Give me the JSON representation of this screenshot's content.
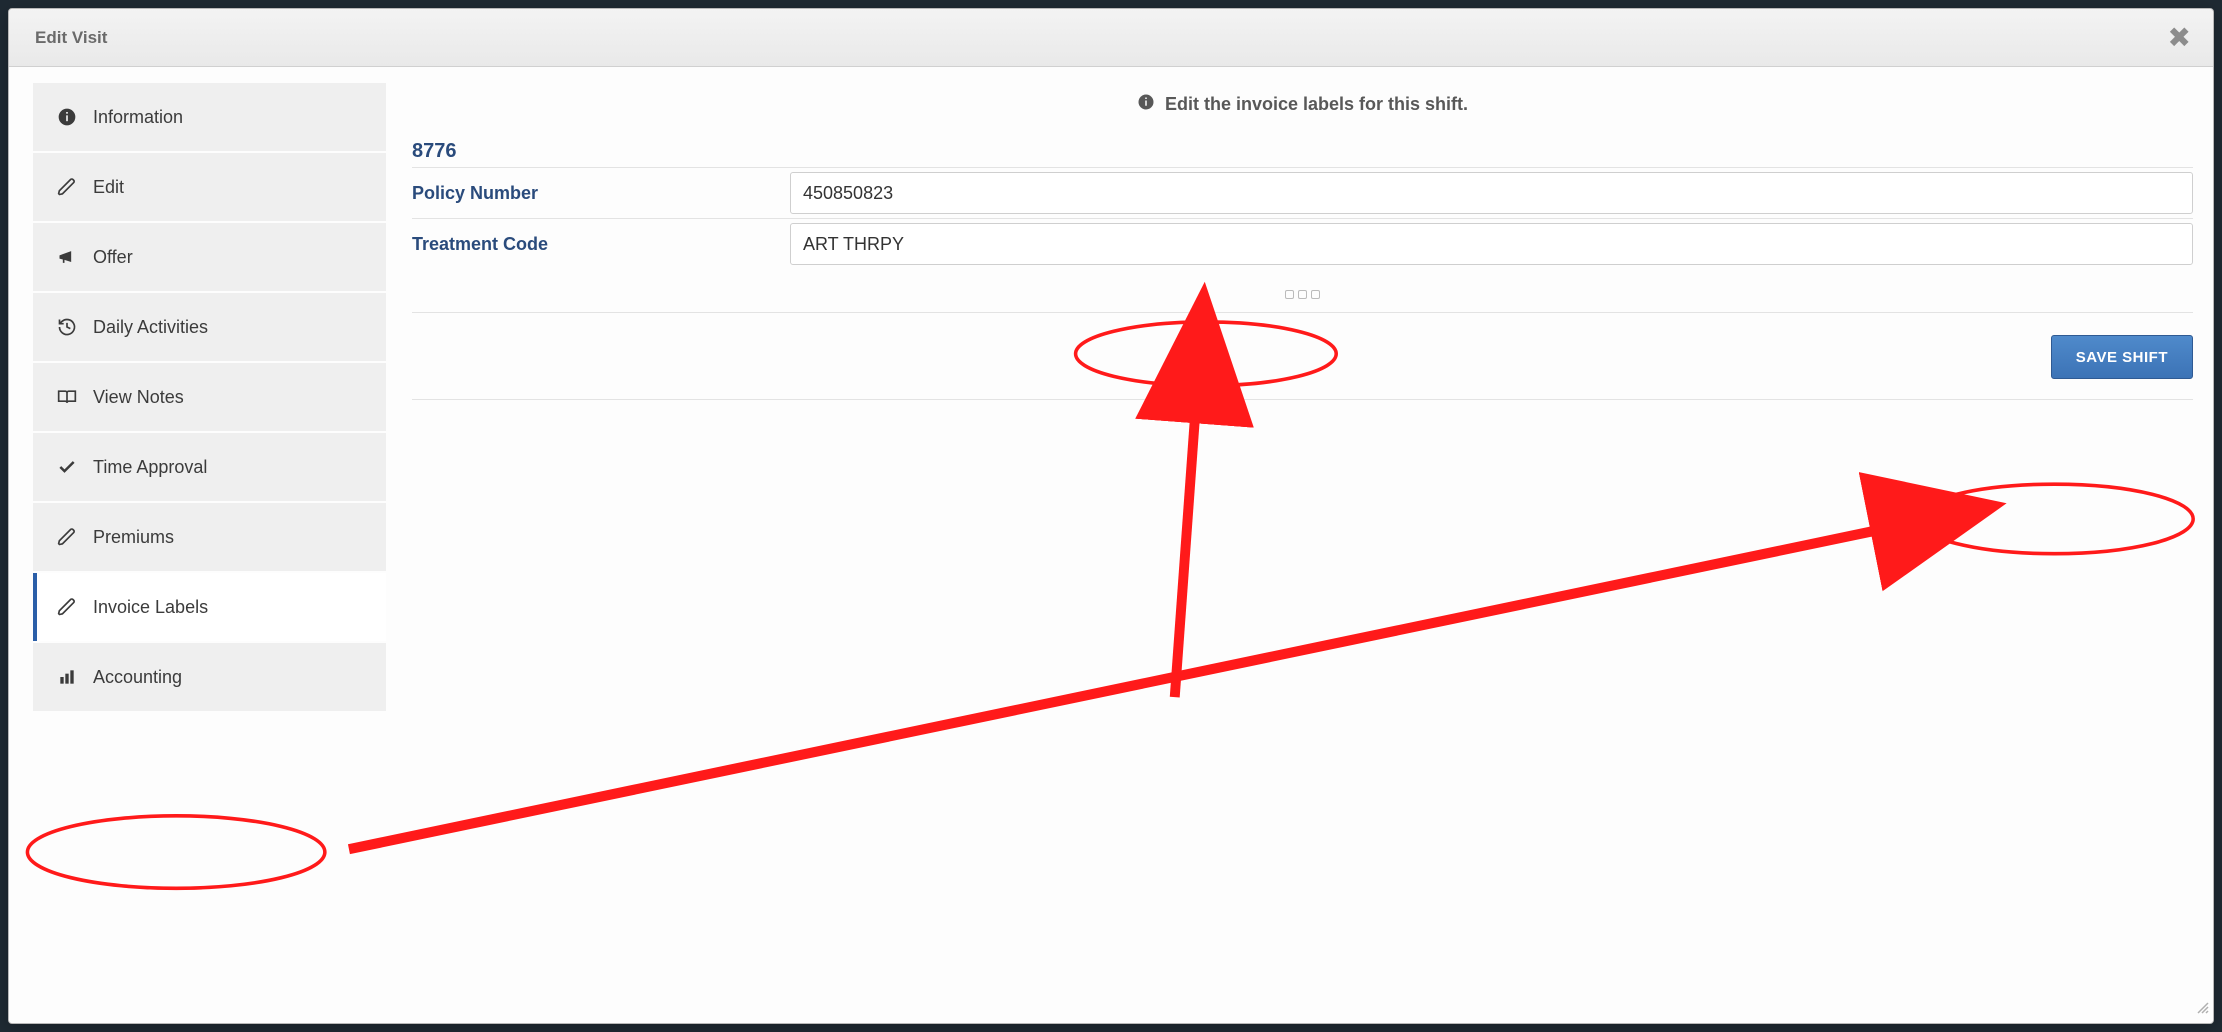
{
  "modal": {
    "title": "Edit Visit"
  },
  "sidebar": {
    "items": [
      {
        "label": "Information",
        "icon": "info-circle",
        "active": false
      },
      {
        "label": "Edit",
        "icon": "pencil",
        "active": false
      },
      {
        "label": "Offer",
        "icon": "bullhorn",
        "active": false
      },
      {
        "label": "Daily Activities",
        "icon": "history",
        "active": false
      },
      {
        "label": "View Notes",
        "icon": "book-open",
        "active": false
      },
      {
        "label": "Time Approval",
        "icon": "check",
        "active": false
      },
      {
        "label": "Premiums",
        "icon": "pencil",
        "active": false
      },
      {
        "label": "Invoice Labels",
        "icon": "pencil",
        "active": true
      },
      {
        "label": "Accounting",
        "icon": "bar-chart",
        "active": false
      }
    ]
  },
  "content": {
    "helper": "Edit the invoice labels for this shift.",
    "section_id": "8776",
    "fields": {
      "policy_number": {
        "label": "Policy Number",
        "value": "450850823"
      },
      "treatment_code": {
        "label": "Treatment Code",
        "value": "ART THRPY"
      }
    },
    "save_label": "SAVE SHIFT"
  },
  "annotations": {
    "circle_treatment_code": true,
    "circle_save_button": true,
    "circle_invoice_labels": true,
    "arrow_treatment_to_input": true,
    "arrow_save_to_sidebar": true
  }
}
